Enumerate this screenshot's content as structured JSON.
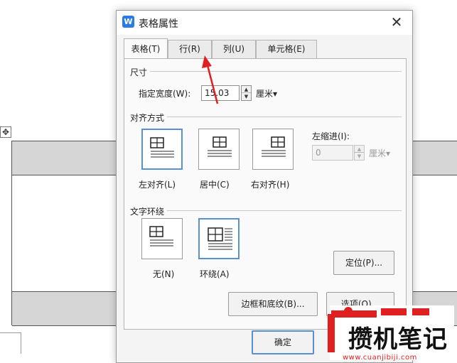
{
  "dialog": {
    "title": "表格属性",
    "close_glyph": "✕",
    "app_icon_glyph": "W"
  },
  "tabs": [
    {
      "label": "表格(T)",
      "active": true
    },
    {
      "label": "行(R)",
      "active": false
    },
    {
      "label": "列(U)",
      "active": false
    },
    {
      "label": "单元格(E)",
      "active": false
    }
  ],
  "size_section": {
    "label": "尺寸",
    "width_label": "指定宽度(W):",
    "width_value": "15.03",
    "unit": "厘米▾"
  },
  "alignment_section": {
    "label": "对齐方式",
    "options": [
      {
        "label": "左对齐(L)",
        "selected": true
      },
      {
        "label": "居中(C)",
        "selected": false
      },
      {
        "label": "右对齐(H)",
        "selected": false
      }
    ],
    "indent_label": "左缩进(I):",
    "indent_value": "0",
    "indent_unit": "厘米▾"
  },
  "wrap_section": {
    "label": "文字环绕",
    "options": [
      {
        "label": "无(N)",
        "selected": false
      },
      {
        "label": "环绕(A)",
        "selected": true
      }
    ],
    "position_button": "定位(P)..."
  },
  "buttons": {
    "borders": "边框和底纹(B)...",
    "options": "选项(O)...",
    "ok": "确定"
  },
  "background": {
    "move_handle_glyph": "✥"
  },
  "watermark": {
    "name": "攒机笔记",
    "url": "www.cuanjibiji.com"
  },
  "colors": {
    "accent": "#5a8fd0",
    "annotation_arrow": "#e02020",
    "watermark_red": "#e02020"
  }
}
